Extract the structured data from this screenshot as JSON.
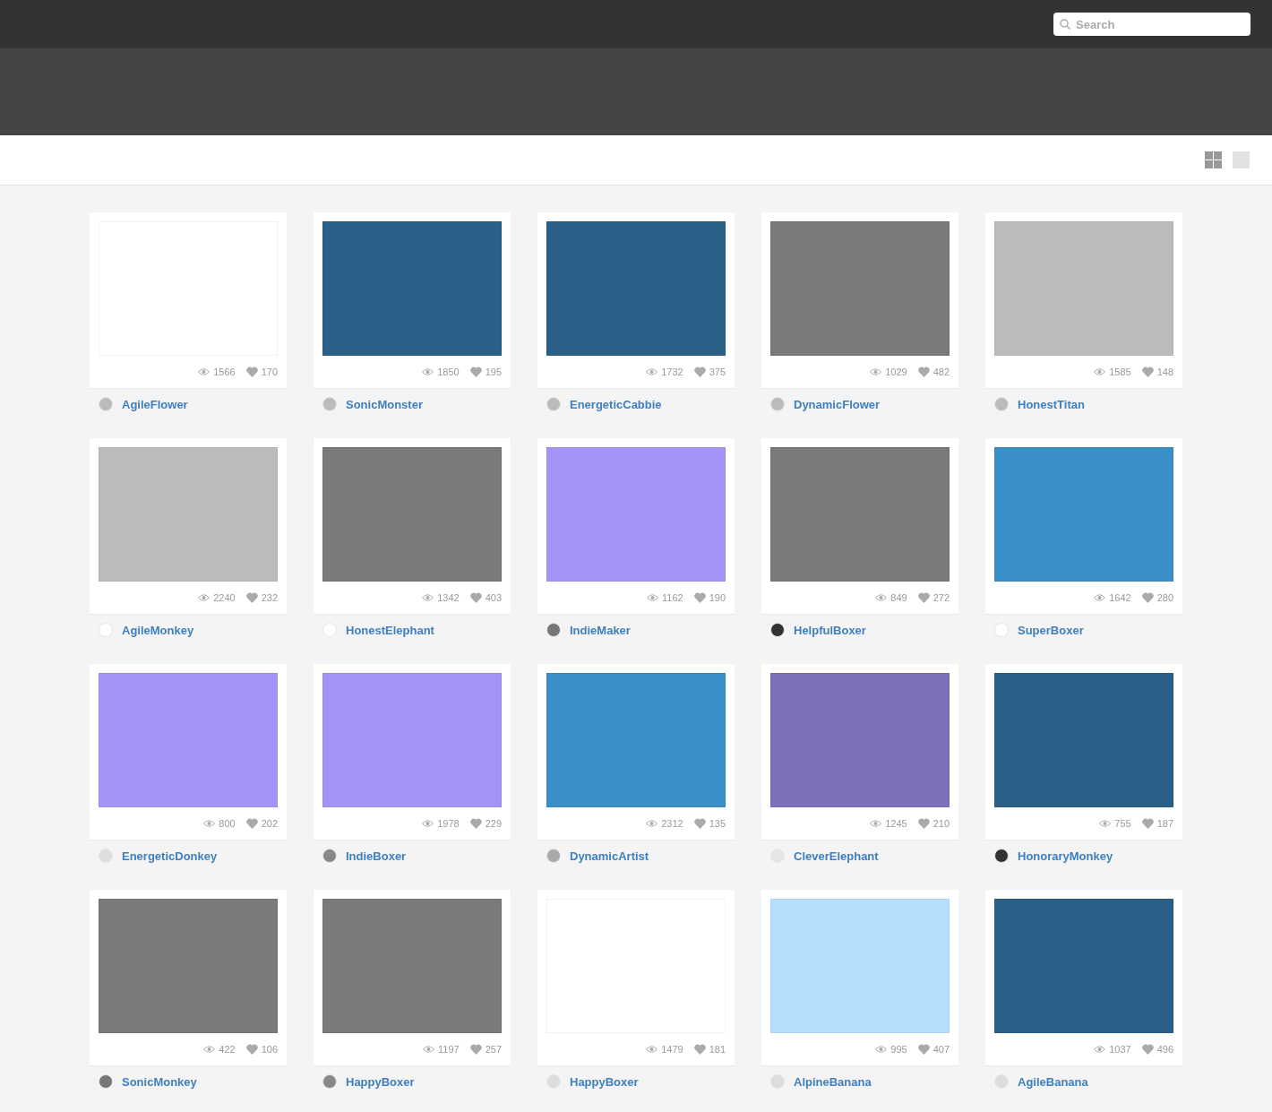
{
  "search": {
    "placeholder": "Search"
  },
  "view_toggles": [
    {
      "kind": "grid",
      "selected": true
    },
    {
      "kind": "single",
      "selected": false
    }
  ],
  "shots": [
    {
      "color": "#ffffff",
      "views": "1566",
      "likes": "170",
      "avatar": {
        "color": "#bbbbbb"
      },
      "name": "AgileFlower"
    },
    {
      "color": "#2a5f88",
      "views": "1850",
      "likes": "195",
      "avatar": {
        "color": "#bbbbbb"
      },
      "name": "SonicMonster"
    },
    {
      "color": "#2a5f88",
      "views": "1732",
      "likes": "375",
      "avatar": {
        "color": "#bbbbbb"
      },
      "name": "EnergeticCabbie"
    },
    {
      "color": "#7a7a7a",
      "views": "1029",
      "likes": "482",
      "avatar": {
        "color": "#bbbbbb"
      },
      "name": "DynamicFlower"
    },
    {
      "color": "#bbbbbb",
      "views": "1585",
      "likes": "148",
      "avatar": {
        "color": "#bbbbbb"
      },
      "name": "HonestTitan"
    },
    {
      "color": "#bbbbbb",
      "views": "2240",
      "likes": "232",
      "avatar": {
        "color": "#ffffff"
      },
      "name": "AgileMonkey"
    },
    {
      "color": "#7a7a7a",
      "views": "1342",
      "likes": "403",
      "avatar": {
        "color": "#ffffff"
      },
      "name": "HonestElephant"
    },
    {
      "color": "#a594f7",
      "views": "1162",
      "likes": "190",
      "avatar": {
        "color": "#777777"
      },
      "name": "IndieMaker"
    },
    {
      "color": "#7a7a7a",
      "views": "849",
      "likes": "272",
      "avatar": {
        "color": "#333333"
      },
      "name": "HelpfulBoxer"
    },
    {
      "color": "#3a8fc8",
      "views": "1642",
      "likes": "280",
      "avatar": {
        "color": "#ffffff"
      },
      "name": "SuperBoxer"
    },
    {
      "color": "#a594f7",
      "views": "800",
      "likes": "202",
      "avatar": {
        "color": "#dddddd"
      },
      "name": "EnergeticDonkey"
    },
    {
      "color": "#a594f7",
      "views": "1978",
      "likes": "229",
      "avatar": {
        "color": "#888888"
      },
      "name": "IndieBoxer"
    },
    {
      "color": "#3a8fc8",
      "views": "2312",
      "likes": "135",
      "avatar": {
        "color": "#aaaaaa"
      },
      "name": "DynamicArtist"
    },
    {
      "color": "#7e6fba",
      "views": "1245",
      "likes": "210",
      "avatar": {
        "color": "#e5e5e5"
      },
      "name": "CleverElephant"
    },
    {
      "color": "#2a5f88",
      "views": "755",
      "likes": "187",
      "avatar": {
        "color": "#333333"
      },
      "name": "HonoraryMonkey"
    },
    {
      "color": "#7a7a7a",
      "views": "422",
      "likes": "106",
      "avatar": {
        "color": "#777777"
      },
      "name": "SonicMonkey"
    },
    {
      "color": "#7a7a7a",
      "views": "1197",
      "likes": "257",
      "avatar": {
        "color": "#888888"
      },
      "name": "HappyBoxer"
    },
    {
      "color": "#ffffff",
      "views": "1479",
      "likes": "181",
      "avatar": {
        "color": "#dddddd"
      },
      "name": "HappyBoxer"
    },
    {
      "color": "#b3dffc",
      "views": "995",
      "likes": "407",
      "avatar": {
        "color": "#dddddd"
      },
      "name": "AlpineBanana"
    },
    {
      "color": "#2a5f88",
      "views": "1037",
      "likes": "496",
      "avatar": {
        "color": "#dddddd"
      },
      "name": "AgileBanana"
    }
  ]
}
